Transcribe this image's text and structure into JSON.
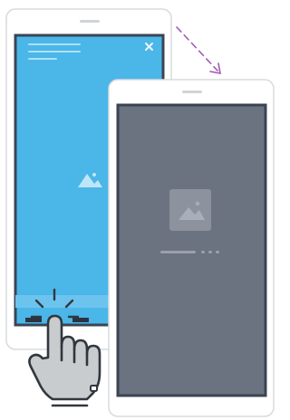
{
  "colors": {
    "device_body": "#ffffff",
    "device_outline": "#d7dbde",
    "screen_blue": "#4bb6e8",
    "screen_dark": "#6b7280",
    "frame_dark": "#3a4453",
    "arrow": "#a05ab0",
    "hand_fill": "#c9ccce",
    "hand_stroke": "#31373f"
  },
  "icons": {
    "close": "close-icon",
    "image_blue": "image-icon",
    "image_dark": "image-placeholder-icon",
    "loading": "loading-indicator",
    "hand": "tapping-hand-icon",
    "arrow": "transition-arrow"
  }
}
